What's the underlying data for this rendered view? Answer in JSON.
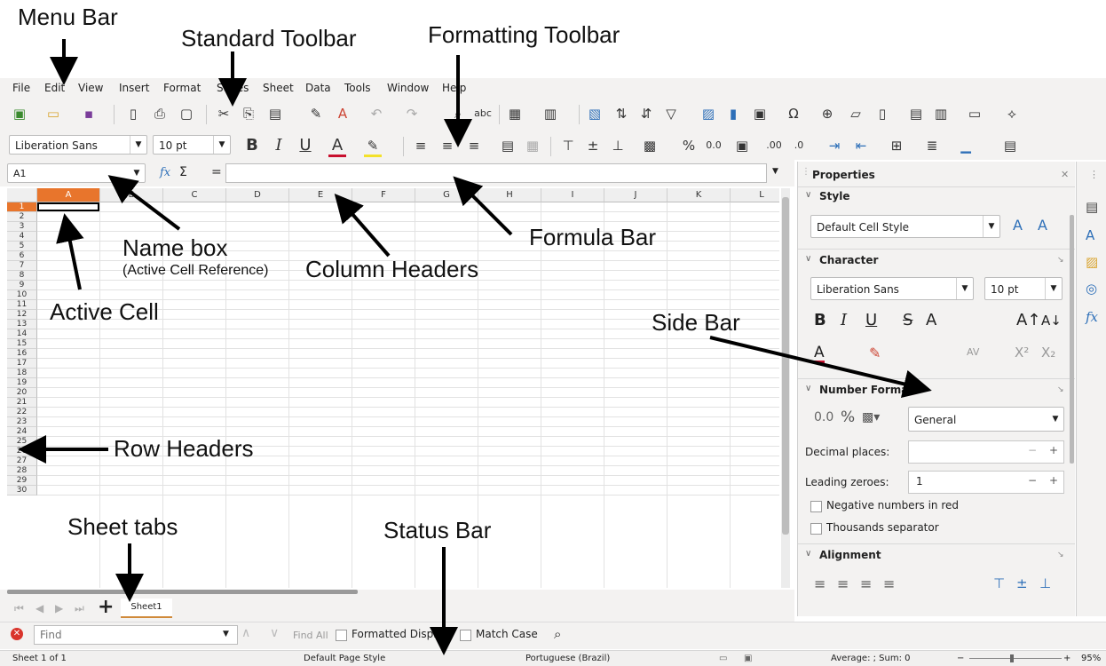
{
  "annotations": {
    "menu_bar": "Menu Bar",
    "standard_toolbar": "Standard Toolbar",
    "formatting_toolbar": "Formatting Toolbar",
    "name_box": "Name box",
    "name_box_sub": "(Active Cell Reference)",
    "column_headers": "Column Headers",
    "formula_bar": "Formula Bar",
    "active_cell": "Active Cell",
    "side_bar": "Side Bar",
    "row_headers": "Row Headers",
    "sheet_tabs": "Sheet tabs",
    "status_bar": "Status Bar"
  },
  "menu": [
    "File",
    "Edit",
    "View",
    "Insert",
    "Format",
    "Styles",
    "Sheet",
    "Data",
    "Tools",
    "Window",
    "Help"
  ],
  "formatting": {
    "font_name": "Liberation Sans",
    "font_size": "10 pt",
    "bold": "B",
    "italic": "I",
    "underline": "U",
    "font_color": "A",
    "percent": "%",
    "decimal": "0.0"
  },
  "formula": {
    "name_box": "A1",
    "fx": "fx",
    "sum": "Σ",
    "equals": "="
  },
  "columns": [
    "A",
    "B",
    "C",
    "D",
    "E",
    "F",
    "G",
    "H",
    "I",
    "J",
    "K",
    "L"
  ],
  "rows": [
    "1",
    "2",
    "3",
    "4",
    "5",
    "6",
    "7",
    "8",
    "9",
    "10",
    "11",
    "12",
    "13",
    "14",
    "15",
    "16",
    "17",
    "18",
    "19",
    "20",
    "21",
    "22",
    "23",
    "24",
    "25",
    "26",
    "27",
    "28",
    "29",
    "30"
  ],
  "sheet_tab": "Sheet1",
  "add_sheet": "+",
  "find": {
    "placeholder": "Find",
    "find_all": "Find All",
    "formatted_display": "Formatted Display",
    "match_case": "Match Case"
  },
  "status": {
    "sheet": "Sheet 1 of 1",
    "page_style": "Default Page Style",
    "language": "Portuguese (Brazil)",
    "summary": "Average: ; Sum: 0",
    "zoom": "95%"
  },
  "sidebar": {
    "title": "Properties",
    "style_section": "Style",
    "cell_style": "Default Cell Style",
    "character_section": "Character",
    "font_name": "Liberation Sans",
    "font_size": "10 pt",
    "number_format_section": "Number Format",
    "number_category": "General",
    "decimal_places_label": "Decimal places:",
    "decimal_places_value": "",
    "leading_zeroes_label": "Leading zeroes:",
    "leading_zeroes_value": "1",
    "negative_red": "Negative numbers in red",
    "thousands_sep": "Thousands separator",
    "alignment_section": "Alignment",
    "minus": "−",
    "plus": "+"
  },
  "colors": {
    "active_header": "#e8752c",
    "chrome": "#f3f2f1",
    "accent_red": "#d9342b"
  }
}
